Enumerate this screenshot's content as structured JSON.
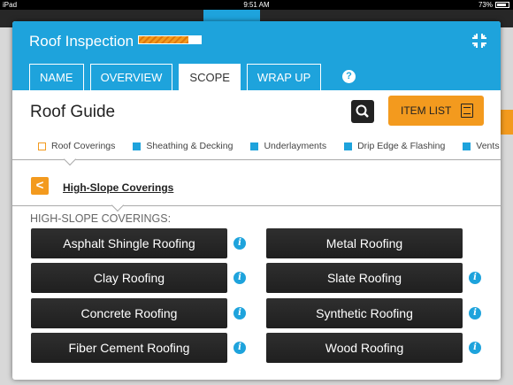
{
  "status_bar": {
    "carrier": "iPad",
    "time": "9:51 AM",
    "battery": "73%"
  },
  "header": {
    "title": "Roof Inspection",
    "progress_fraction": 0.8
  },
  "tabs": [
    {
      "label": "NAME",
      "active": false
    },
    {
      "label": "OVERVIEW",
      "active": false
    },
    {
      "label": "SCOPE",
      "active": true
    },
    {
      "label": "WRAP UP",
      "active": false
    }
  ],
  "help_label": "?",
  "guide": {
    "title": "Roof Guide",
    "item_list_label": "ITEM LIST"
  },
  "categories": [
    {
      "label": "Roof Coverings",
      "active": true
    },
    {
      "label": "Sheathing & Decking",
      "active": false
    },
    {
      "label": "Underlayments",
      "active": false
    },
    {
      "label": "Drip Edge & Flashing",
      "active": false
    },
    {
      "label": "Vents & F",
      "active": false
    }
  ],
  "section": {
    "back_label": "<",
    "link": "High-Slope Coverings",
    "heading": "HIGH-SLOPE COVERINGS:"
  },
  "coverings": [
    {
      "label": "Asphalt Shingle Roofing",
      "info": true
    },
    {
      "label": "Metal Roofing",
      "info": false
    },
    {
      "label": "Clay Roofing",
      "info": true
    },
    {
      "label": "Slate Roofing",
      "info": true
    },
    {
      "label": "Concrete Roofing",
      "info": true
    },
    {
      "label": "Synthetic Roofing",
      "info": true
    },
    {
      "label": "Fiber Cement Roofing",
      "info": true
    },
    {
      "label": "Wood Roofing",
      "info": true
    }
  ],
  "info_glyph": "i",
  "colors": {
    "accent_blue": "#1ea3dc",
    "accent_orange": "#f39a1e",
    "button_dark": "#2a2a2a"
  }
}
